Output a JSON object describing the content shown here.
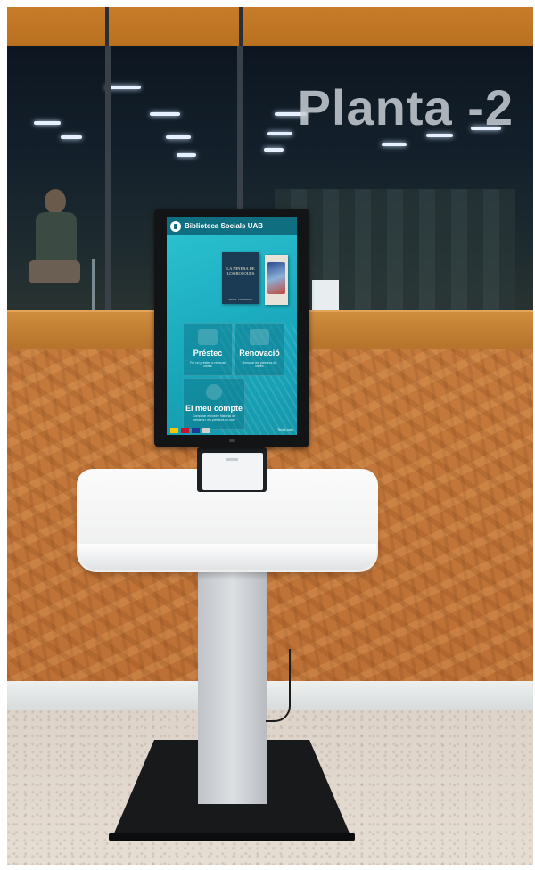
{
  "scene": {
    "floor_sign": "Planta -2"
  },
  "kiosk": {
    "header_title": "Biblioteca Socials UAB",
    "featured_books": [
      {
        "title": "LA NIÑERA DE LOS BOSQUES",
        "author": "PER J. ANDERSEN"
      }
    ],
    "tiles": [
      {
        "label": "Préstec",
        "subtitle": "Fer un préstec o retornar llibres",
        "icon": "book-basket-icon"
      },
      {
        "label": "Renovació",
        "subtitle": "Renovar els préstecs de llibres",
        "icon": "calendar-renew-icon"
      },
      {
        "label": "El meu compte",
        "subtitle": "Consultar el vostre historial de préstecs i els préstecs en curs",
        "icon": "person-icon"
      }
    ],
    "languages": [
      "Català",
      "Español",
      "English",
      "Français"
    ],
    "language_colors": [
      "#f4c900",
      "#c8102e",
      "#1f3a93",
      "#d0d0d0"
    ],
    "brand": "TechLogic"
  }
}
